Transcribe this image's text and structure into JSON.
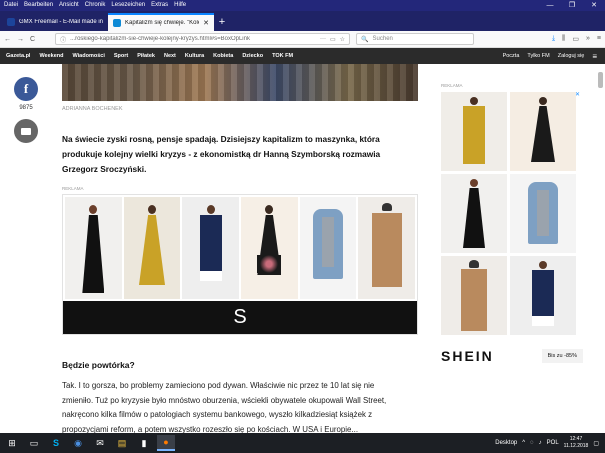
{
  "menubar": {
    "items": [
      "Datei",
      "Bearbeiten",
      "Ansicht",
      "Chronik",
      "Lesezeichen",
      "Extras",
      "Hilfe"
    ],
    "controls": [
      "—",
      "❐",
      "✕"
    ]
  },
  "tabs": [
    {
      "label": "GMX Freemail - E-Mail made in...",
      "favicon_color": "#1c449b",
      "active": false
    },
    {
      "label": "Kapitalizm się chwieje. \"Kolej...",
      "favicon_color": "#0e8ad6",
      "active": true
    }
  ],
  "newtab_label": "+",
  "navbar": {
    "back": "←",
    "forward": "→",
    "reload": "C",
    "url": "...roskiego-kapitalizm-sie-chwieje-kolejny-kryzys.html#s=BoxOpLink",
    "url_info": "ⓘ",
    "url_more": "···",
    "search_placeholder": "Suchen",
    "search_icon": "🔍",
    "tools": [
      "⤓",
      "⫼",
      "▭",
      "»",
      "≡"
    ]
  },
  "sitenav": {
    "logo": "Gazeta.pl",
    "items": [
      "Weekend",
      "Wiadomości",
      "Sport",
      "Piłatek",
      "Next",
      "Kultura",
      "Kobieta",
      "Dziecko",
      "TOK FM"
    ],
    "right": [
      "Poczta",
      "Tylko FM",
      "Zaloguj się"
    ],
    "menu_icon": "≡"
  },
  "article": {
    "share_count": "9875",
    "photo_credit": "ADRIANNA BOCHENEK",
    "lead": "Na świecie zyski rosną, pensje spadają. Dzisiejszy kapitalizm to maszynka, która produkuje kolejny wielki kryzys - z ekonomistką dr Hanną Szymborską rozmawia Grzegorz Sroczyński.",
    "ad_label": "REKLAMA",
    "ad_brand_letter": "S",
    "ad_close": "▷ ✕",
    "heading": "Będzie powtórka?",
    "body": "Tak. I to gorsza, bo problemy zamieciono pod dywan. Właściwie nic przez te 10 lat się nie zmieniło. Tuż po kryzysie było mnóstwo oburzenia, wściekli obywatele okupowali Wall Street, nakręcono kilka filmów o patologiach systemu bankowego, wyszło kilkadziesiąt książek z propozycjami reform, a potem wszystko rozeszło się po kościach. W USA i Europie..."
  },
  "sidead": {
    "label": "REKLAMA",
    "brand": "SHEIN",
    "cta": "Bis zu -85%",
    "close": "▷ ✕"
  },
  "taskbar": {
    "start": "⊞",
    "apps": [
      "▭",
      "S",
      "◉",
      "✉",
      "▤",
      "▮",
      "●"
    ],
    "tray_label": "Desktop",
    "tray_icons": [
      "^",
      "◌",
      "♪"
    ],
    "lang": "POL",
    "time": "12:47",
    "date": "11.12.2018",
    "notif": "▢"
  }
}
